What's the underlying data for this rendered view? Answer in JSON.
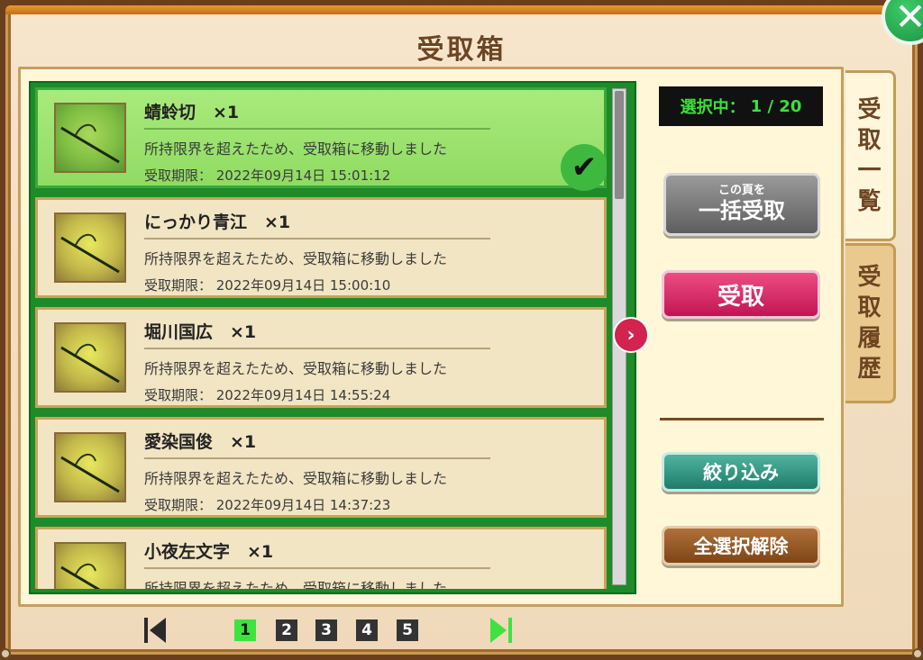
{
  "window": {
    "title": "受取箱"
  },
  "close_icon": "close-icon",
  "selection": {
    "label": "選択中：",
    "value": "1 / 20"
  },
  "items": [
    {
      "name": "蜻蛉切　×1",
      "desc": "所持限界を超えたため、受取箱に移動しました",
      "deadline": "受取期限：  2022年09月14日 15:01:12",
      "selected": true
    },
    {
      "name": "にっかり青江　×1",
      "desc": "所持限界を超えたため、受取箱に移動しました",
      "deadline": "受取期限：  2022年09月14日 15:00:10",
      "selected": false
    },
    {
      "name": "堀川国広　×1",
      "desc": "所持限界を超えたため、受取箱に移動しました",
      "deadline": "受取期限：  2022年09月14日 14:55:24",
      "selected": false
    },
    {
      "name": "愛染国俊　×1",
      "desc": "所持限界を超えたため、受取箱に移動しました",
      "deadline": "受取期限：  2022年09月14日 14:37:23",
      "selected": false
    },
    {
      "name": "小夜左文字　×1",
      "desc": "所持限界を超えたため、受取箱に移動しました",
      "deadline": "",
      "selected": false
    }
  ],
  "buttons": {
    "bulk_small": "この頁を",
    "bulk_big": "一括受取",
    "receive": "受取",
    "filter": "絞り込み",
    "deselect": "全選択解除"
  },
  "tabs": {
    "list": [
      "受",
      "取",
      "一",
      "覧"
    ],
    "history": [
      "受",
      "取",
      "履",
      "歴"
    ]
  },
  "pager": {
    "pages": [
      "1",
      "2",
      "3",
      "4",
      "5"
    ],
    "current": "1"
  },
  "colors": {
    "selected_green": "#8fdc62",
    "list_border": "#1e8a2a",
    "receive_pink": "#c21553",
    "counter_text": "#3be23b"
  }
}
